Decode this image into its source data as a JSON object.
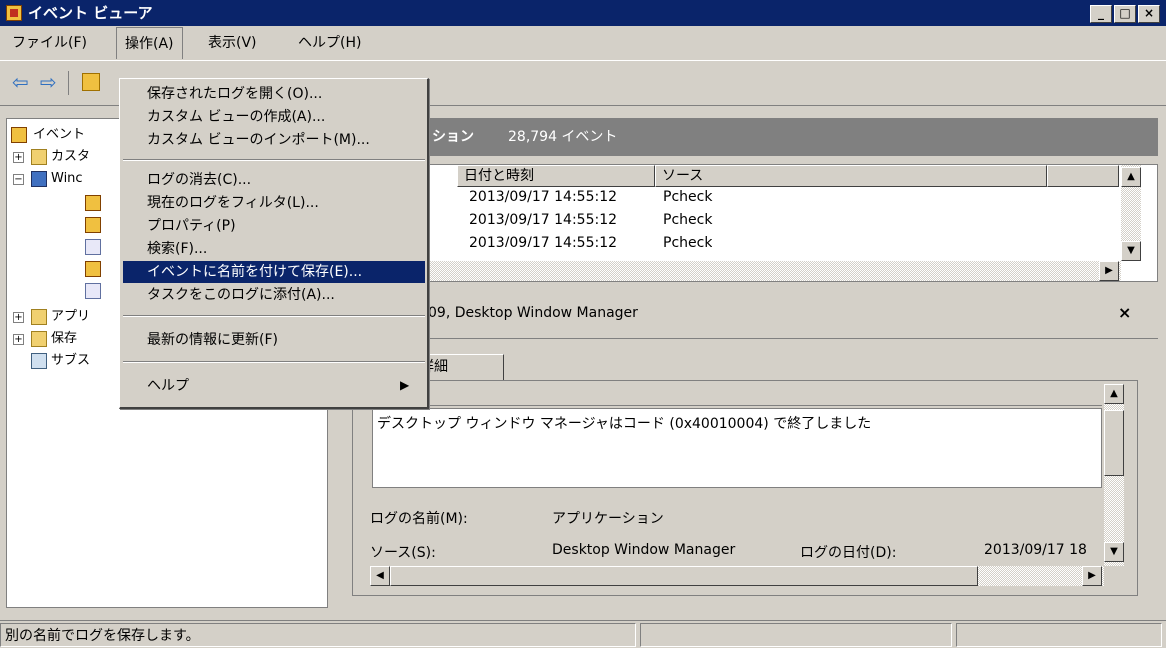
{
  "window": {
    "title": "イベント ビューア",
    "min": "_",
    "max": "□",
    "close": "×"
  },
  "menubar": {
    "file": "ファイル(F)",
    "action": "操作(A)",
    "view": "表示(V)",
    "help": "ヘルプ(H)"
  },
  "tree": {
    "root": "イベント",
    "items": [
      {
        "label": "カスタ"
      },
      {
        "label": "Winc"
      },
      {
        "label": "アプリ"
      },
      {
        "label": "保存"
      },
      {
        "label": "サブス"
      }
    ]
  },
  "header": {
    "section": "ション",
    "count": "28,794 イベント"
  },
  "event_list": {
    "columns": [
      "日付と時刻",
      "ソース"
    ],
    "rows": [
      {
        "date": "2013/09/17 14:55:12",
        "source": "Pcheck"
      },
      {
        "date": "2013/09/17 14:55:12",
        "source": "Pcheck"
      },
      {
        "date": "2013/09/17 14:55:12",
        "source": "Pcheck"
      }
    ]
  },
  "detail": {
    "title": "09, Desktop Window Manager",
    "close": "×",
    "tab_detail": "詳細",
    "description": "デスクトップ ウィンドウ マネージャはコード (0x40010004) で終了しました",
    "log_name_label": "ログの名前(M):",
    "log_name_value": "アプリケーション",
    "source_label": "ソース(S):",
    "source_value": "Desktop Window Manager",
    "logged_label": "ログの日付(D):",
    "logged_value": "2013/09/17 18"
  },
  "menu": {
    "items": [
      {
        "label": "保存されたログを開く(O)..."
      },
      {
        "label": "カスタム ビューの作成(A)..."
      },
      {
        "label": "カスタム ビューのインポート(M)..."
      },
      {
        "label": "ログの消去(C)..."
      },
      {
        "label": "現在のログをフィルタ(L)..."
      },
      {
        "label": "プロパティ(P)"
      },
      {
        "label": "検索(F)..."
      },
      {
        "label": "イベントに名前を付けて保存(E)..."
      },
      {
        "label": "タスクをこのログに添付(A)..."
      },
      {
        "label": "最新の情報に更新(F)"
      },
      {
        "label": "ヘルプ"
      }
    ]
  },
  "status": {
    "text": "別の名前でログを保存します。"
  },
  "colors": {
    "title_bg": "#0a246a",
    "highlight": "#0a246a",
    "face": "#d4d0c8"
  }
}
